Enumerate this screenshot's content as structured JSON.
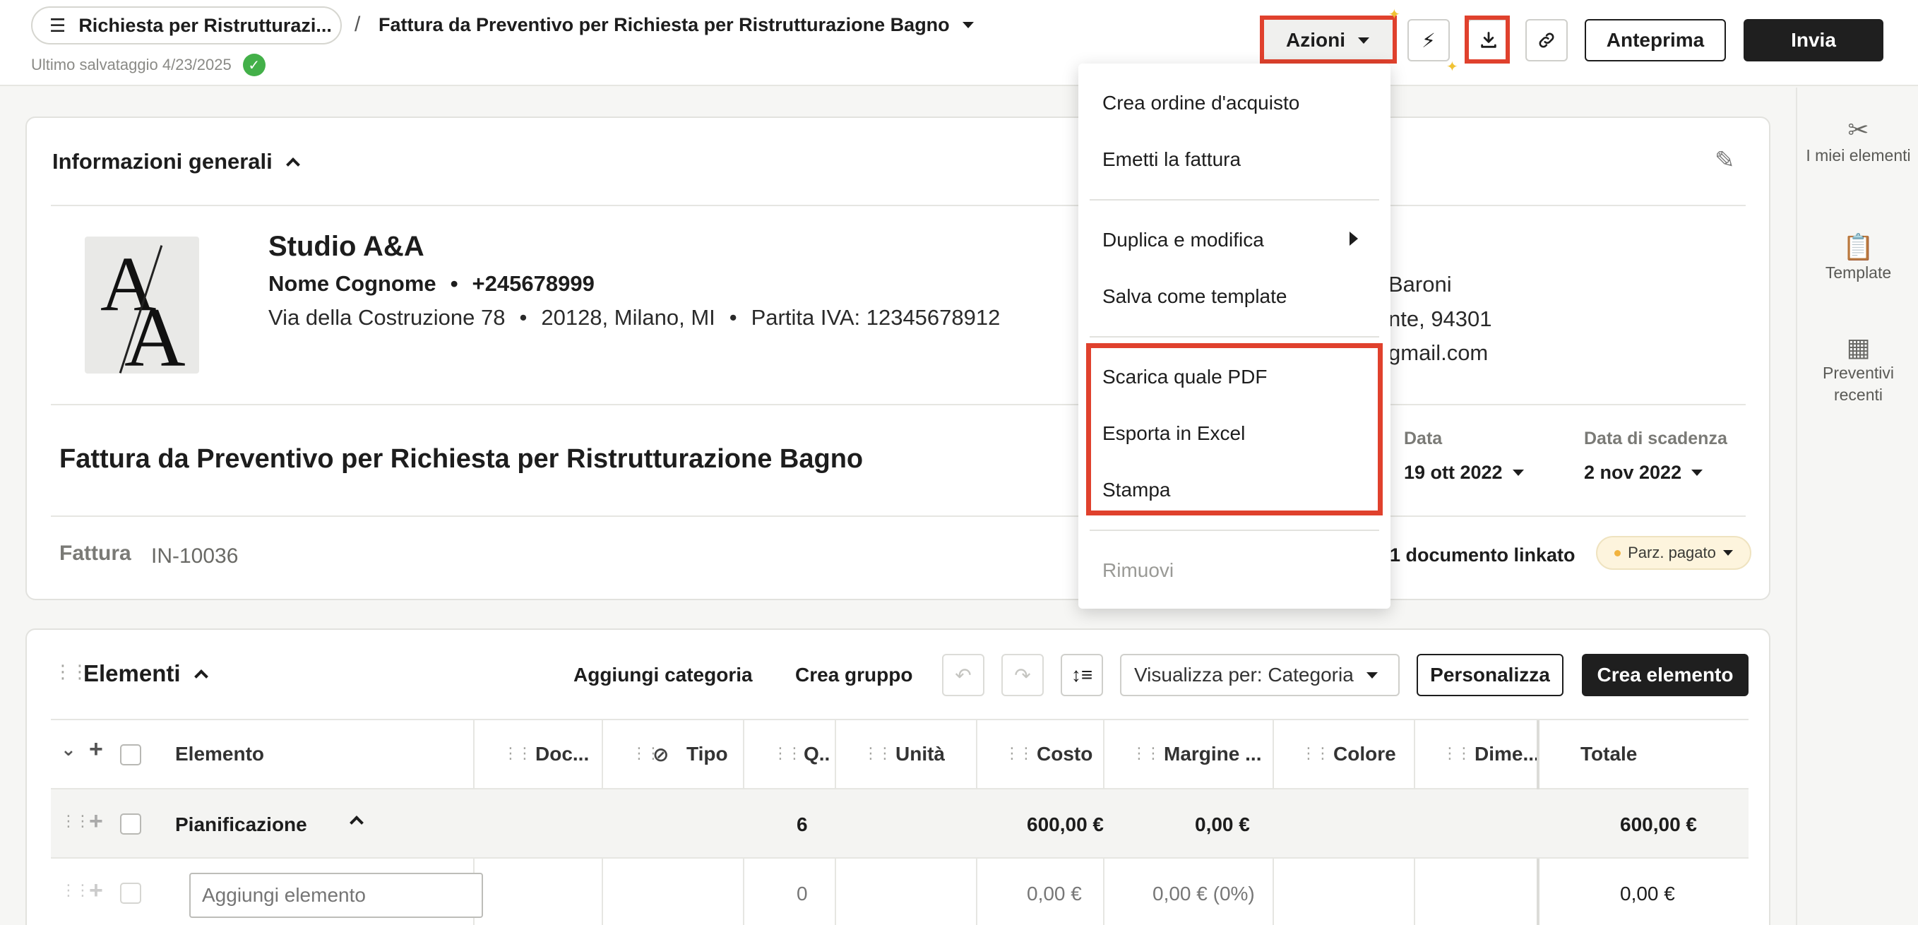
{
  "header": {
    "project_pill": "Richiesta per Ristrutturazi...",
    "separator": "/",
    "doc_title": "Fattura da Preventivo per Richiesta per Ristrutturazione Bagno",
    "saved_text": "Ultimo salvataggio 4/23/2025",
    "azioni_label": "Azioni",
    "anteprima_label": "Anteprima",
    "invia_label": "Invia"
  },
  "menu": {
    "items": [
      {
        "label": "Crea ordine d'acquisto"
      },
      {
        "label": "Emetti la fattura"
      },
      {
        "label": "Duplica e modifica"
      },
      {
        "label": "Salva come template"
      },
      {
        "label": "Scarica quale PDF"
      },
      {
        "label": "Esporta in Excel"
      },
      {
        "label": "Stampa"
      },
      {
        "label": "Rimuovi"
      }
    ]
  },
  "rail": {
    "items": [
      {
        "label": "I miei elementi",
        "icon": "tools-icon"
      },
      {
        "label": "Template",
        "icon": "clipboard-icon"
      },
      {
        "label": "Preventivi recenti",
        "icon": "calculator-icon"
      }
    ]
  },
  "info": {
    "section_title": "Informazioni generali",
    "company_name": "Studio A&A",
    "contact_name": "Nome Cognome",
    "phone": "+245678999",
    "street": "Via della Costruzione 78",
    "city": "20128, Milano, MI",
    "vat": "Partita IVA: 12345678912",
    "client_line1": "Baroni",
    "client_line2": "nte, 94301",
    "client_line3": "gmail.com",
    "doc_title": "Fattura da Preventivo per Richiesta per Ristrutturazione Bagno",
    "date_label": "Data",
    "date_value": "19 ott 2022",
    "due_label": "Data di scadenza",
    "due_value": "2 nov 2022",
    "invoice_label": "Fattura",
    "invoice_number": "IN-10036",
    "linked_docs": "1 documento linkato",
    "status_badge": "Parz. pagato"
  },
  "elements": {
    "title": "Elementi",
    "add_category": "Aggiungi categoria",
    "create_group": "Crea gruppo",
    "view_by": "Visualizza per: Categoria",
    "personalize": "Personalizza",
    "create_element": "Crea elemento",
    "columns": [
      "Elemento",
      "Doc...",
      "Tipo",
      "Q..",
      "Unità",
      "Costo",
      "Margine ...",
      "Colore",
      "Dime...",
      "Totale"
    ],
    "group_row": {
      "name": "Pianificazione",
      "qty": "6",
      "cost": "600,00 €",
      "margin": "0,00 €",
      "total": "600,00 €"
    },
    "add_row": {
      "placeholder": "Aggiungi elemento",
      "qty": "0",
      "cost": "0,00 €",
      "margin": "0,00 € (0%)",
      "total": "0,00 €"
    }
  },
  "colors": {
    "highlight": "#e0412d",
    "primary_dark": "#1f1f1f",
    "success": "#43b049",
    "badge_bg": "#fdf4dd"
  }
}
